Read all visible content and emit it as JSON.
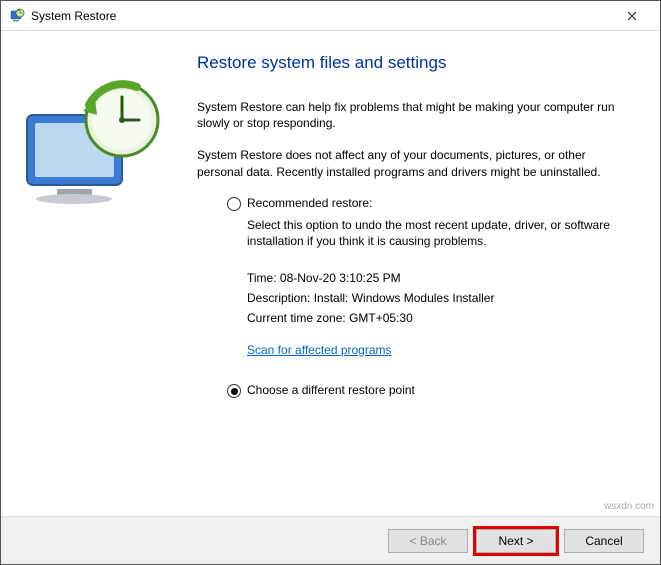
{
  "window": {
    "title": "System Restore"
  },
  "heading": "Restore system files and settings",
  "intro1": "System Restore can help fix problems that might be making your computer run slowly or stop responding.",
  "intro2": "System Restore does not affect any of your documents, pictures, or other personal data. Recently installed programs and drivers might be uninstalled.",
  "option_recommended": {
    "label": "Recommended restore:",
    "desc": "Select this option to undo the most recent update, driver, or software installation if you think it is causing problems.",
    "time_label": "Time:",
    "time_value": "08-Nov-20 3:10:25 PM",
    "desc_label": "Description:",
    "desc_value": "Install: Windows Modules Installer",
    "tz_label": "Current time zone:",
    "tz_value": "GMT+05:30",
    "scan_link": "Scan for affected programs"
  },
  "option_different": {
    "label": "Choose a different restore point"
  },
  "buttons": {
    "back": "< Back",
    "next": "Next >",
    "cancel": "Cancel"
  },
  "watermark": "wsxdn.com"
}
